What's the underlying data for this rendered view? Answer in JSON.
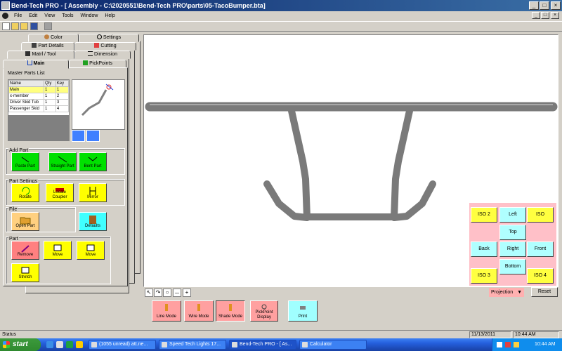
{
  "window": {
    "title": "Bend-Tech PRO - [ Assembly - C:\\2020551\\Bend-Tech PRO\\parts\\05-TacoBumper.bta]",
    "controls": [
      "_",
      "□",
      "×"
    ],
    "mdi_controls": [
      "_",
      "□",
      "×"
    ]
  },
  "menu": [
    "File",
    "Edit",
    "View",
    "Tools",
    "Window",
    "Help"
  ],
  "tabs": {
    "row1": [
      "Color",
      "Settings"
    ],
    "row2": [
      "Part Details",
      "Cutting"
    ],
    "row3": [
      "Matrl / Tool",
      "Dimension"
    ],
    "row4": [
      "Main",
      "PickPoints"
    ]
  },
  "master_parts": {
    "title": "Master Parts List",
    "headers": [
      "Name",
      "Qty",
      "Key"
    ],
    "rows": [
      [
        "Main",
        "1",
        "1"
      ],
      [
        "x-member",
        "1",
        "2"
      ],
      [
        "Driver Skid Tub",
        "1",
        "3"
      ],
      [
        "Passenger Skid",
        "1",
        "4"
      ]
    ]
  },
  "add_part": {
    "title": "Add Part",
    "buttons": [
      "Paste Part",
      "Straight Part",
      "Bent Part"
    ]
  },
  "part_settings": {
    "title": "Part Settings",
    "buttons": [
      "Rotate",
      "Locate Coupler",
      "Mirror"
    ]
  },
  "file_group": {
    "title": "File",
    "buttons": [
      "Open Part",
      "Defaults"
    ]
  },
  "part_group": {
    "title": "Part",
    "buttons": [
      "Remove",
      "Move",
      "Move",
      "Stretch"
    ]
  },
  "view_buttons": {
    "iso2": "ISO 2",
    "left": "Left",
    "iso": "ISO",
    "top": "Top",
    "back": "Back",
    "right": "Right",
    "front": "Front",
    "bottom": "Bottom",
    "iso3": "ISO 3",
    "iso4": "ISO 4"
  },
  "projection": "Projection",
  "reset": "Reset",
  "modes": [
    "Line Mode",
    "Wire Mode",
    "Shade Mode",
    "PickPoint Display",
    "Print"
  ],
  "status": {
    "label": "Status",
    "date": "11/13/2011",
    "time": "10:44 AM"
  },
  "taskbar": {
    "start": "start",
    "tasks": [
      "(1055 unread) att.ne...",
      "Speed Tech Lights 17...",
      "Bend-Tech PRO - [ As...",
      "Calculator"
    ],
    "clock": "10:44 AM"
  },
  "colors": {
    "title_bar": "#0a246a",
    "taskbar": "#245edb",
    "tube": "#7a7a7a"
  }
}
